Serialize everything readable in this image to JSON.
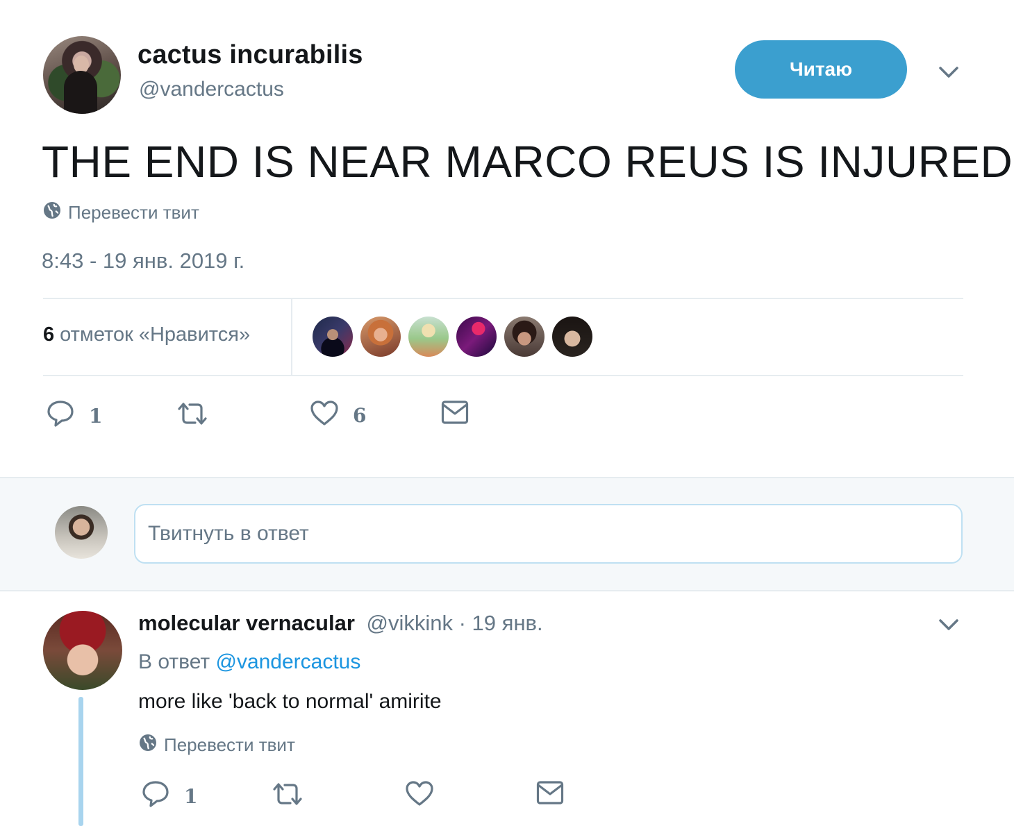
{
  "tweet": {
    "author": {
      "display_name": "cactus incurabilis",
      "handle": "@vandercactus"
    },
    "follow_button": "Читаю",
    "text": "THE END IS NEAR MARCO REUS IS INJURED",
    "translate_label": "Перевести твит",
    "timestamp": "8:43 - 19 янв. 2019 г.",
    "likes": {
      "count": "6",
      "label": "отметок «Нравится»"
    },
    "likers": [
      {
        "name": "liker-1",
        "color": "#1e2a4a"
      },
      {
        "name": "liker-2",
        "color": "#c8703a"
      },
      {
        "name": "liker-3",
        "color": "#9ac88a"
      },
      {
        "name": "liker-4",
        "color": "#7a1a7a"
      },
      {
        "name": "liker-5",
        "color": "#4a3a36"
      },
      {
        "name": "liker-6",
        "color": "#2a2420"
      }
    ],
    "actions": {
      "reply_count": "1",
      "retweet_count": "",
      "like_count": "6"
    }
  },
  "reply_box": {
    "placeholder": "Твитнуть в ответ"
  },
  "reply": {
    "display_name": "molecular vernacular",
    "handle": "@vikkink",
    "time": "· 19 янв.",
    "in_reply_to_label": "В ответ",
    "in_reply_to_handle": "@vandercactus",
    "text": "more like 'back to normal' amirite",
    "translate_label": "Перевести твит",
    "actions": {
      "reply_count": "1",
      "retweet_count": "",
      "like_count": ""
    }
  },
  "colors": {
    "accent": "#1b95e0",
    "follow_button": "#3b9fcf",
    "muted": "#657786",
    "thread_line": "#a8d4ee"
  }
}
